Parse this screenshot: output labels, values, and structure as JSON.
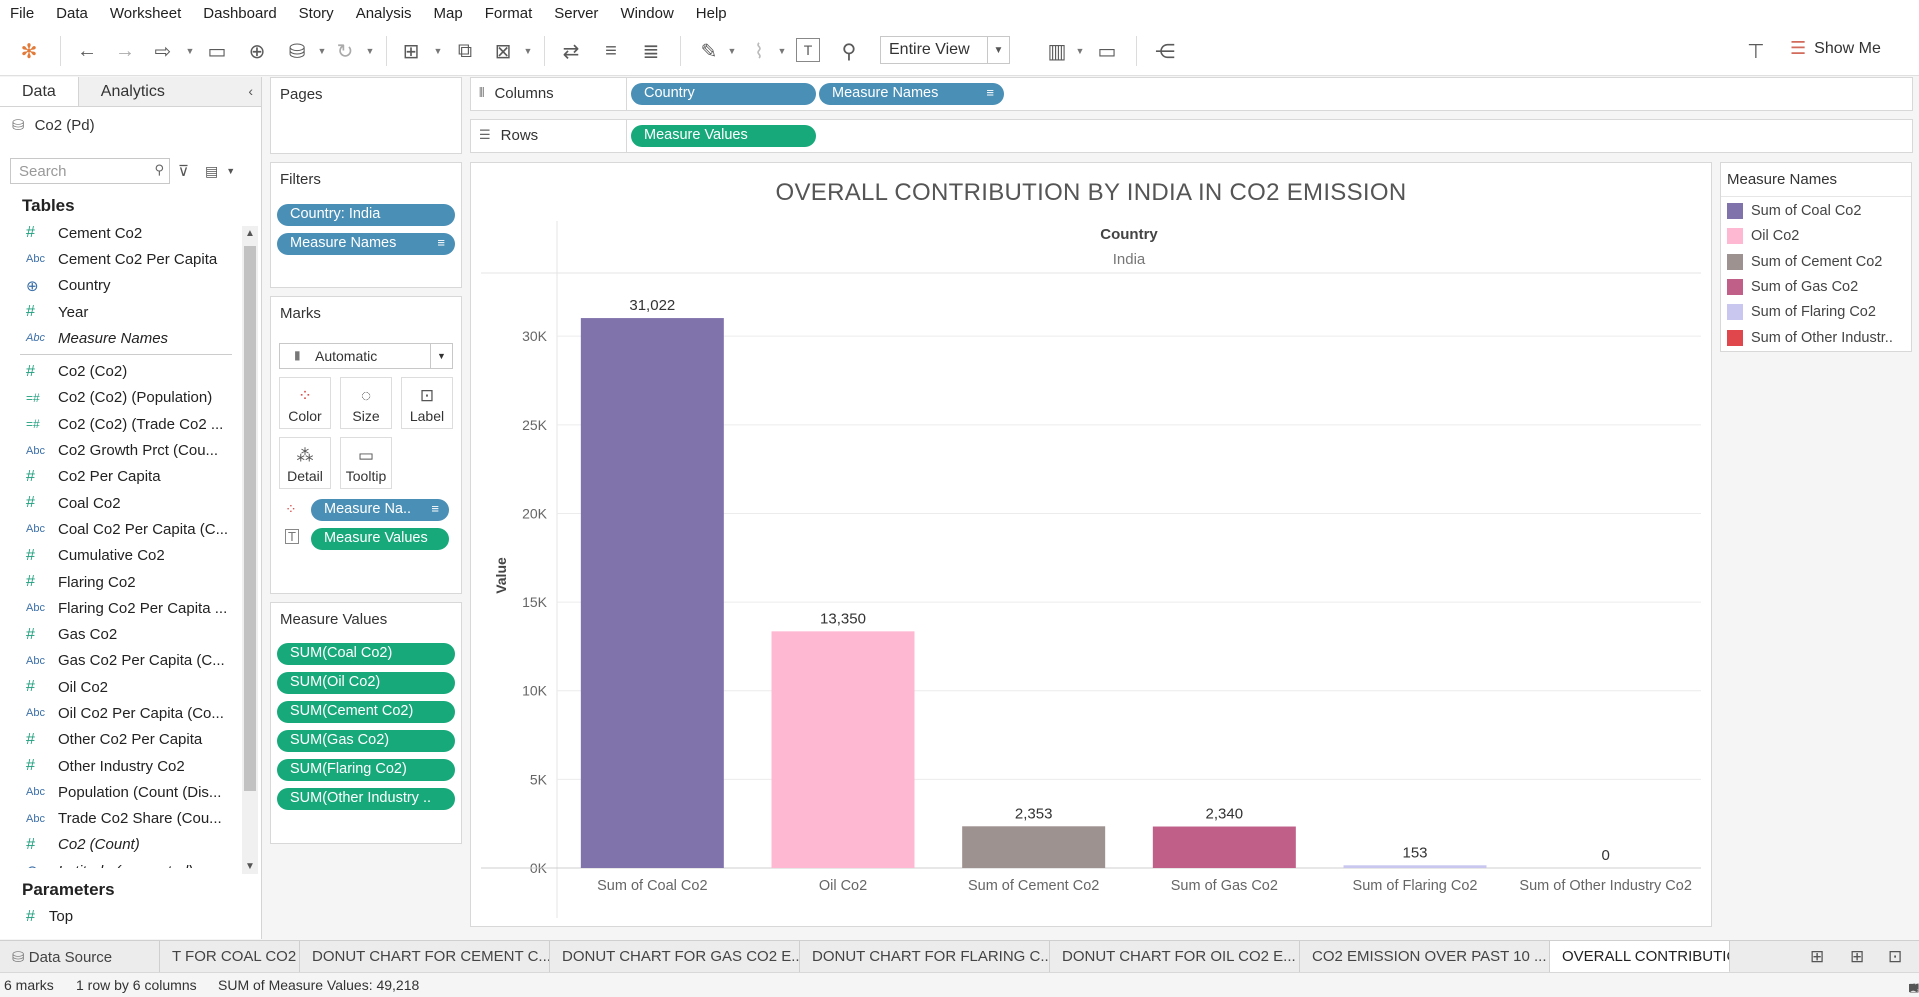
{
  "menu": [
    "File",
    "Data",
    "Worksheet",
    "Dashboard",
    "Story",
    "Analysis",
    "Map",
    "Format",
    "Server",
    "Window",
    "Help"
  ],
  "toolbar": {
    "fit_value": "Entire View",
    "show_me_label": "Show Me"
  },
  "data_pane": {
    "tab_data": "Data",
    "tab_analytics": "Analytics",
    "datasource": "Co2 (Pd)",
    "search_placeholder": "Search",
    "tables_header": "Tables",
    "fields_top": [
      {
        "type": "#",
        "name": "Cement Co2"
      },
      {
        "type": "Abc",
        "name": "Cement Co2 Per Capita"
      },
      {
        "type": "globe",
        "name": "Country"
      },
      {
        "type": "#",
        "name": "Year"
      },
      {
        "type": "Abc",
        "name": "Measure Names",
        "italic": true
      }
    ],
    "fields_bottom": [
      {
        "type": "#",
        "name": "Co2 (Co2)"
      },
      {
        "type": "=#",
        "name": "Co2 (Co2) (Population)"
      },
      {
        "type": "=#",
        "name": "Co2 (Co2) (Trade Co2 ..."
      },
      {
        "type": "Abc",
        "name": "Co2 Growth Prct (Cou..."
      },
      {
        "type": "#",
        "name": "Co2 Per Capita"
      },
      {
        "type": "#",
        "name": "Coal Co2"
      },
      {
        "type": "Abc",
        "name": "Coal Co2 Per Capita (C..."
      },
      {
        "type": "#",
        "name": "Cumulative Co2"
      },
      {
        "type": "#",
        "name": "Flaring Co2"
      },
      {
        "type": "Abc",
        "name": "Flaring Co2 Per Capita ..."
      },
      {
        "type": "#",
        "name": "Gas Co2"
      },
      {
        "type": "Abc",
        "name": "Gas Co2 Per Capita (C..."
      },
      {
        "type": "#",
        "name": "Oil Co2"
      },
      {
        "type": "Abc",
        "name": "Oil Co2 Per Capita (Co..."
      },
      {
        "type": "#",
        "name": "Other Co2 Per Capita"
      },
      {
        "type": "#",
        "name": "Other Industry Co2"
      },
      {
        "type": "Abc",
        "name": "Population (Count (Dis..."
      },
      {
        "type": "Abc",
        "name": "Trade Co2 Share (Cou..."
      },
      {
        "type": "#",
        "name": "Co2 (Count)",
        "italic": true
      },
      {
        "type": "globe",
        "name": "Latitude (generated)",
        "italic": true
      }
    ],
    "parameters_header": "Parameters",
    "parameter": {
      "type": "#",
      "name": "Top"
    }
  },
  "pages": {
    "title": "Pages"
  },
  "filters": {
    "title": "Filters",
    "pills": [
      "Country: India",
      "Measure Names"
    ]
  },
  "marks": {
    "title": "Marks",
    "mark_type": "Automatic",
    "buttons": [
      "Color",
      "Size",
      "Label",
      "Detail",
      "Tooltip"
    ],
    "pills": [
      "Measure Na..",
      "Measure Values"
    ]
  },
  "measure_values": {
    "title": "Measure Values",
    "pills": [
      "SUM(Coal Co2)",
      "SUM(Oil Co2)",
      "SUM(Cement Co2)",
      "SUM(Gas Co2)",
      "SUM(Flaring Co2)",
      "SUM(Other Industry .."
    ]
  },
  "columns": {
    "label": "Columns",
    "pills": [
      "Country",
      "Measure Names"
    ]
  },
  "rows": {
    "label": "Rows",
    "pills": [
      "Measure Values"
    ]
  },
  "legend": {
    "title": "Measure Names",
    "items": [
      {
        "label": "Sum of Coal Co2",
        "color": "#8073ac"
      },
      {
        "label": "Oil Co2",
        "color": "#ffb8d2"
      },
      {
        "label": "Sum of Cement Co2",
        "color": "#9e9290"
      },
      {
        "label": "Sum of Gas Co2",
        "color": "#c06089"
      },
      {
        "label": "Sum of Flaring Co2",
        "color": "#c9c7f0"
      },
      {
        "label": "Sum of Other Industr..",
        "color": "#e0474c"
      }
    ]
  },
  "chart_data": {
    "type": "bar",
    "title": "OVERALL CONTRIBUTION BY INDIA IN CO2 EMISSION",
    "header_field": "Country",
    "header_value": "India",
    "ylabel": "Value",
    "categories": [
      "Sum of Coal Co2",
      "Oil Co2",
      "Sum of Cement Co2",
      "Sum of Gas Co2",
      "Sum of Flaring Co2",
      "Sum of Other Industry Co2"
    ],
    "values": [
      31022,
      13350,
      2353,
      2340,
      153,
      0
    ],
    "value_labels": [
      "31,022",
      "13,350",
      "2,353",
      "2,340",
      "153",
      "0"
    ],
    "colors": [
      "#8073ac",
      "#ffb8d2",
      "#9e9290",
      "#c06089",
      "#c9c7f0",
      "#e0474c"
    ],
    "ylim": [
      0,
      33000
    ],
    "yticks": [
      0,
      5000,
      10000,
      15000,
      20000,
      25000,
      30000
    ],
    "ytick_labels": [
      "0K",
      "5K",
      "10K",
      "15K",
      "20K",
      "25K",
      "30K"
    ],
    "grid": true
  },
  "sheet_tabs": {
    "data_source": "Data Source",
    "tabs": [
      "T FOR COAL CO2",
      "DONUT CHART FOR CEMENT C...",
      "DONUT CHART FOR GAS CO2 E...",
      "DONUT CHART FOR FLARING C...",
      "DONUT CHART FOR OIL CO2 E...",
      "CO2 EMISSION OVER PAST 10 ...",
      "OVERALL CONTRIBUTION BY I..."
    ]
  },
  "status": {
    "marks": "6 marks",
    "layout": "1 row by 6 columns",
    "sum": "SUM of Measure Values: 49,218"
  }
}
